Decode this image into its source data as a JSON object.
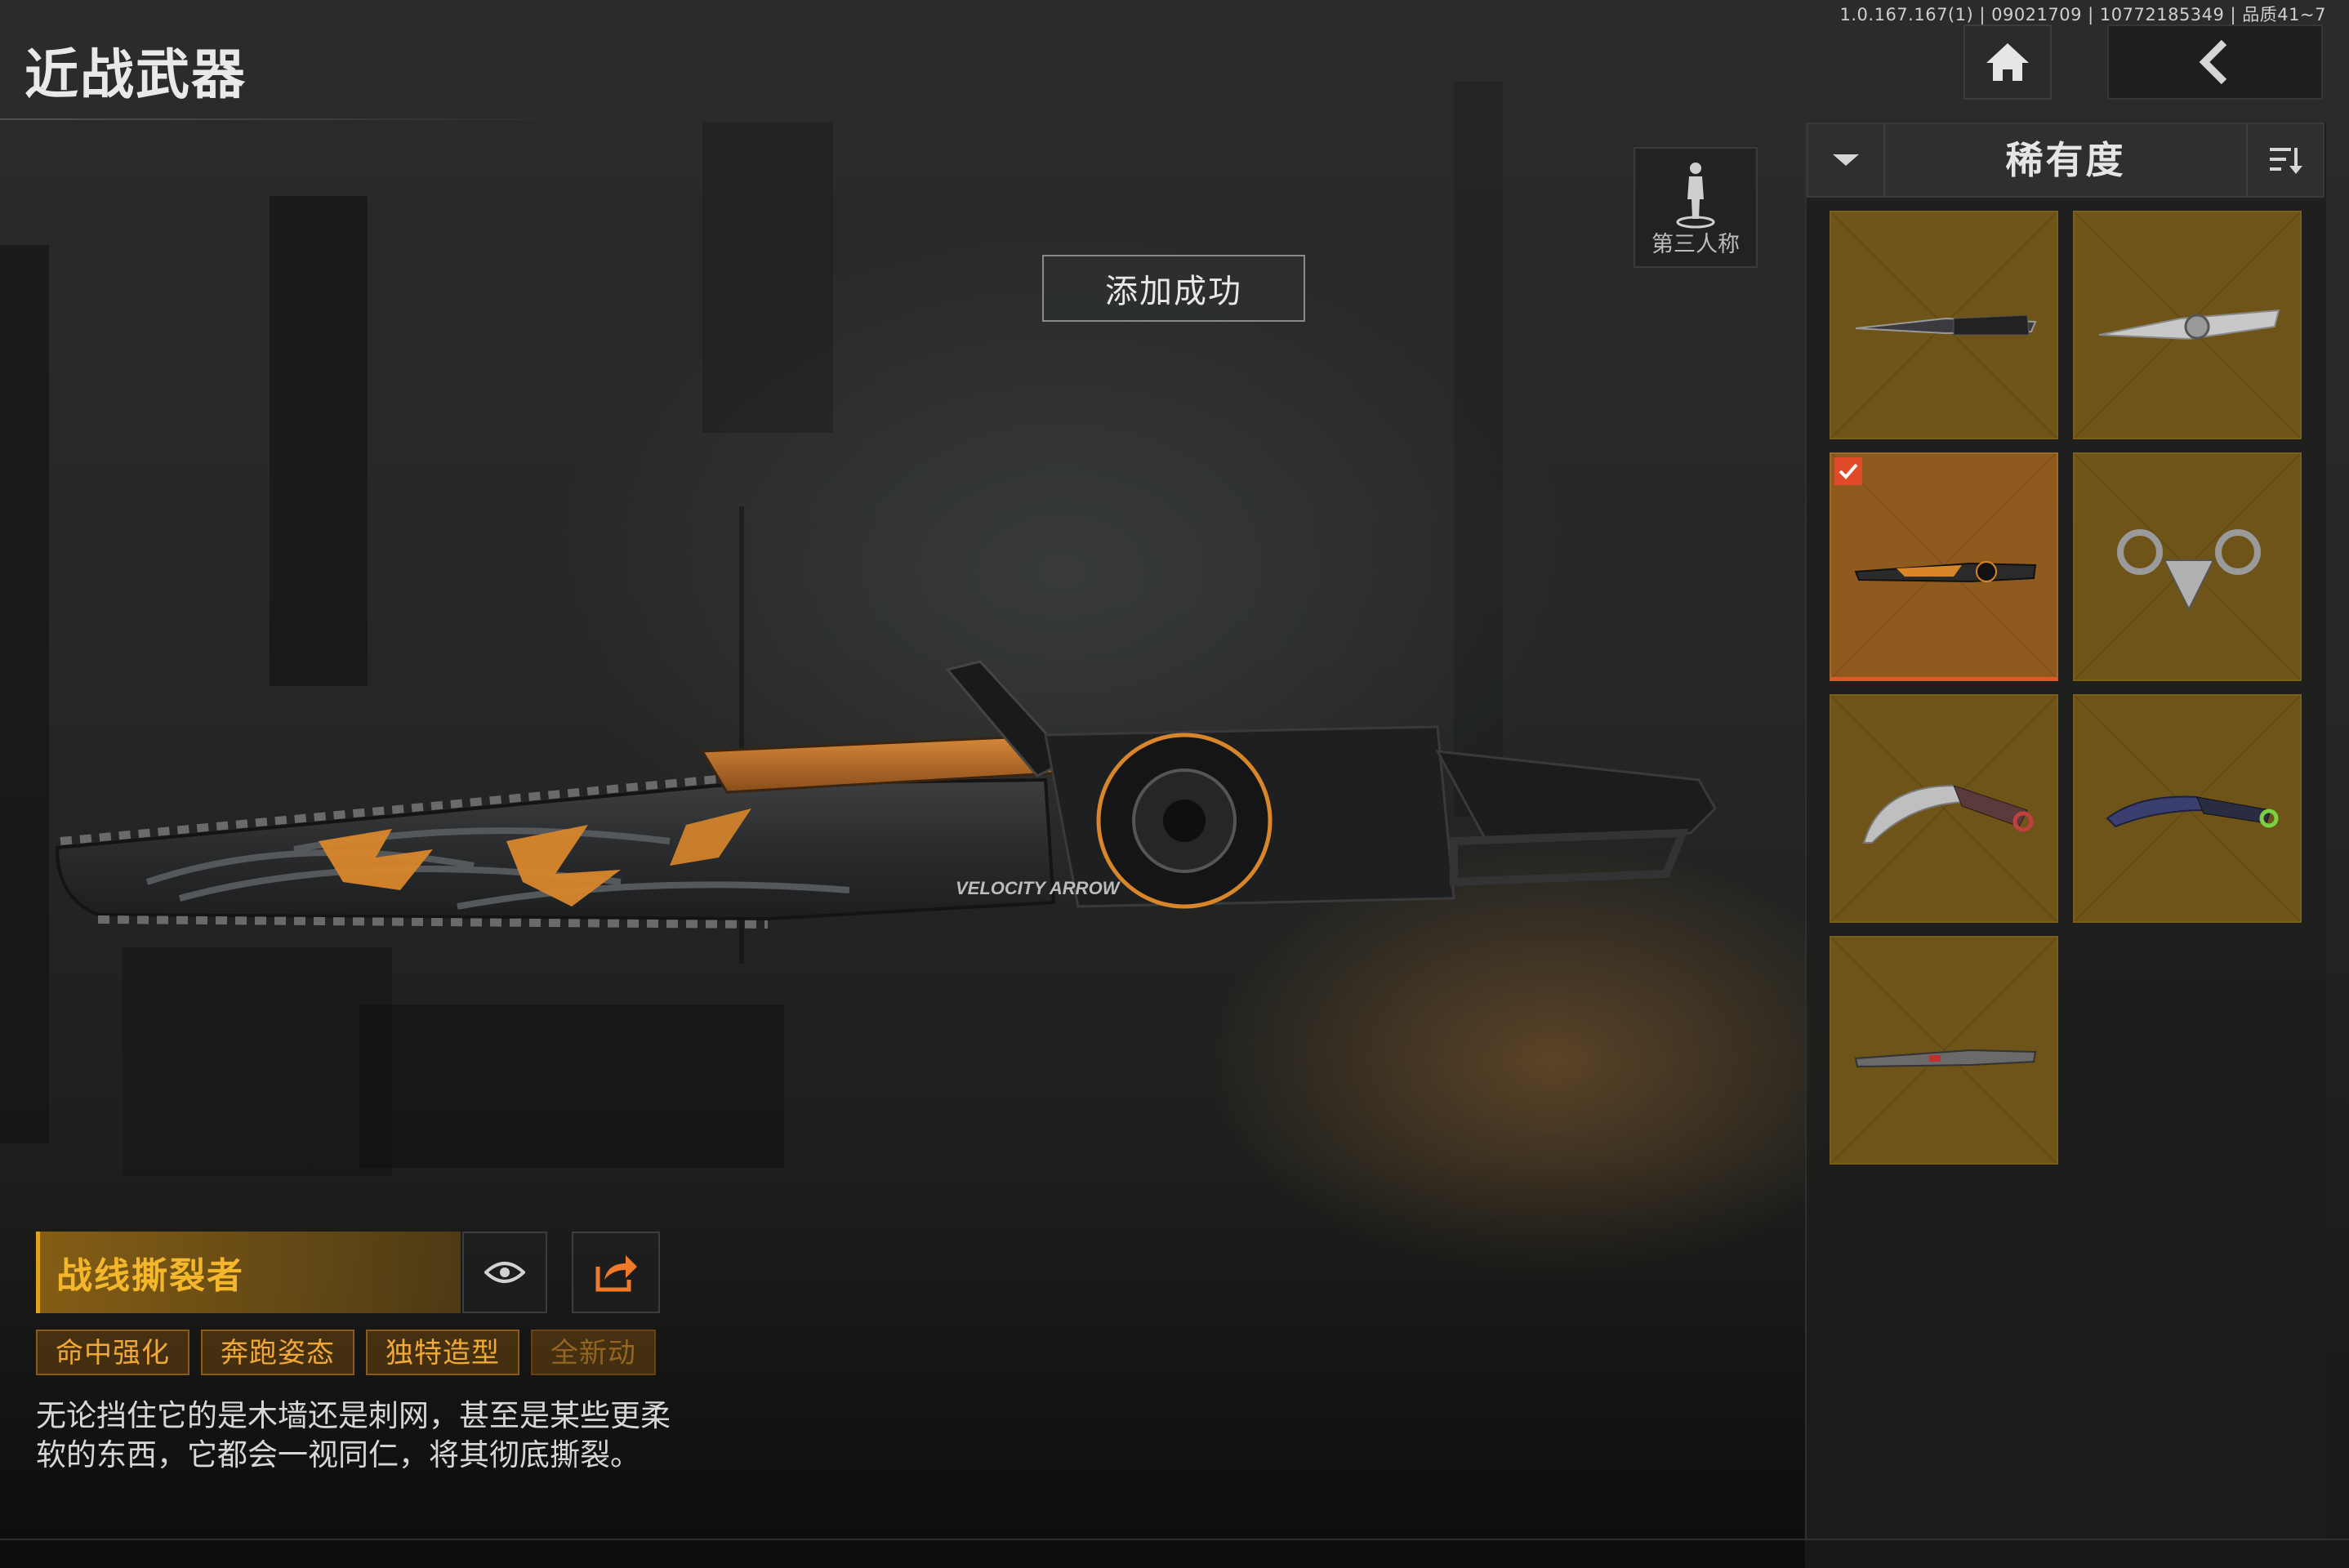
{
  "header": {
    "title": "近战武器",
    "version_info": "1.0.167.167(1) | 09021709 | 10772185349 | 品质41~7",
    "home_icon": "home-icon",
    "back_icon": "chevron-left-icon"
  },
  "camera": {
    "perspective_label": "第三人称",
    "icon": "person-icon"
  },
  "toast": {
    "message": "添加成功"
  },
  "weapon": {
    "name": "战线撕裂者",
    "tags": [
      "命中强化",
      "奔跑姿态",
      "独特造型",
      "全新动"
    ],
    "description": "无论挡住它的是木墙还是刺网，甚至是某些更柔软的东西，它都会一视同仁，将其彻底撕裂。",
    "preview_icon": "eye-icon",
    "share_icon": "share-icon",
    "model_text": "VELOCITY ARROW"
  },
  "inventory": {
    "sort_label": "稀有度",
    "sort_toggle_icon": "chevron-down-icon",
    "sort_order_icon": "sort-icon",
    "items": [
      {
        "kind": "dark-blade",
        "selected": false
      },
      {
        "kind": "silver-blade",
        "selected": false
      },
      {
        "kind": "chainsaw",
        "selected": true
      },
      {
        "kind": "claw-blades",
        "selected": false
      },
      {
        "kind": "karambit",
        "selected": false
      },
      {
        "kind": "blue-karambit",
        "selected": false
      },
      {
        "kind": "machete",
        "selected": false
      }
    ]
  },
  "colors": {
    "accent_orange": "#f4b62a",
    "selected_border": "#e0572a",
    "cell_gold": "#6e5418"
  }
}
